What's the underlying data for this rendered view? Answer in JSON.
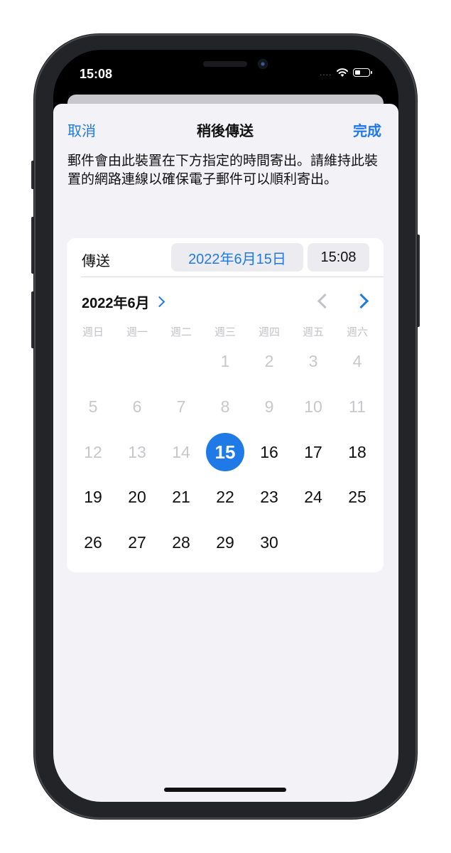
{
  "status_bar": {
    "time": "15:08",
    "signal": "....",
    "battery_level": 0.35
  },
  "nav": {
    "cancel": "取消",
    "title": "稍後傳送",
    "done": "完成"
  },
  "description": "郵件會由此裝置在下方指定的時間寄出。請維持此裝置的網路連線以確保電子郵件可以順利寄出。",
  "send": {
    "label": "傳送",
    "date": "2022年6月15日",
    "time": "15:08"
  },
  "calendar": {
    "month_title": "2022年6月",
    "weekdays": [
      "週日",
      "週一",
      "週二",
      "週三",
      "週四",
      "週五",
      "週六"
    ],
    "selected_day": "15",
    "weeks": [
      [
        "",
        "",
        "",
        "1",
        "2",
        "3",
        "4"
      ],
      [
        "5",
        "6",
        "7",
        "8",
        "9",
        "10",
        "11"
      ],
      [
        "12",
        "13",
        "14",
        "15",
        "16",
        "17",
        "18"
      ],
      [
        "19",
        "20",
        "21",
        "22",
        "23",
        "24",
        "25"
      ],
      [
        "26",
        "27",
        "28",
        "29",
        "30",
        "",
        ""
      ]
    ],
    "unavailable_days": [
      "1",
      "2",
      "3",
      "4",
      "5",
      "6",
      "7",
      "8",
      "9",
      "10",
      "11",
      "12",
      "13",
      "14"
    ]
  },
  "colors": {
    "accent": "#1f7ae8",
    "sheet_bg": "#f2f2f7",
    "disabled": "#c7c7cc"
  }
}
